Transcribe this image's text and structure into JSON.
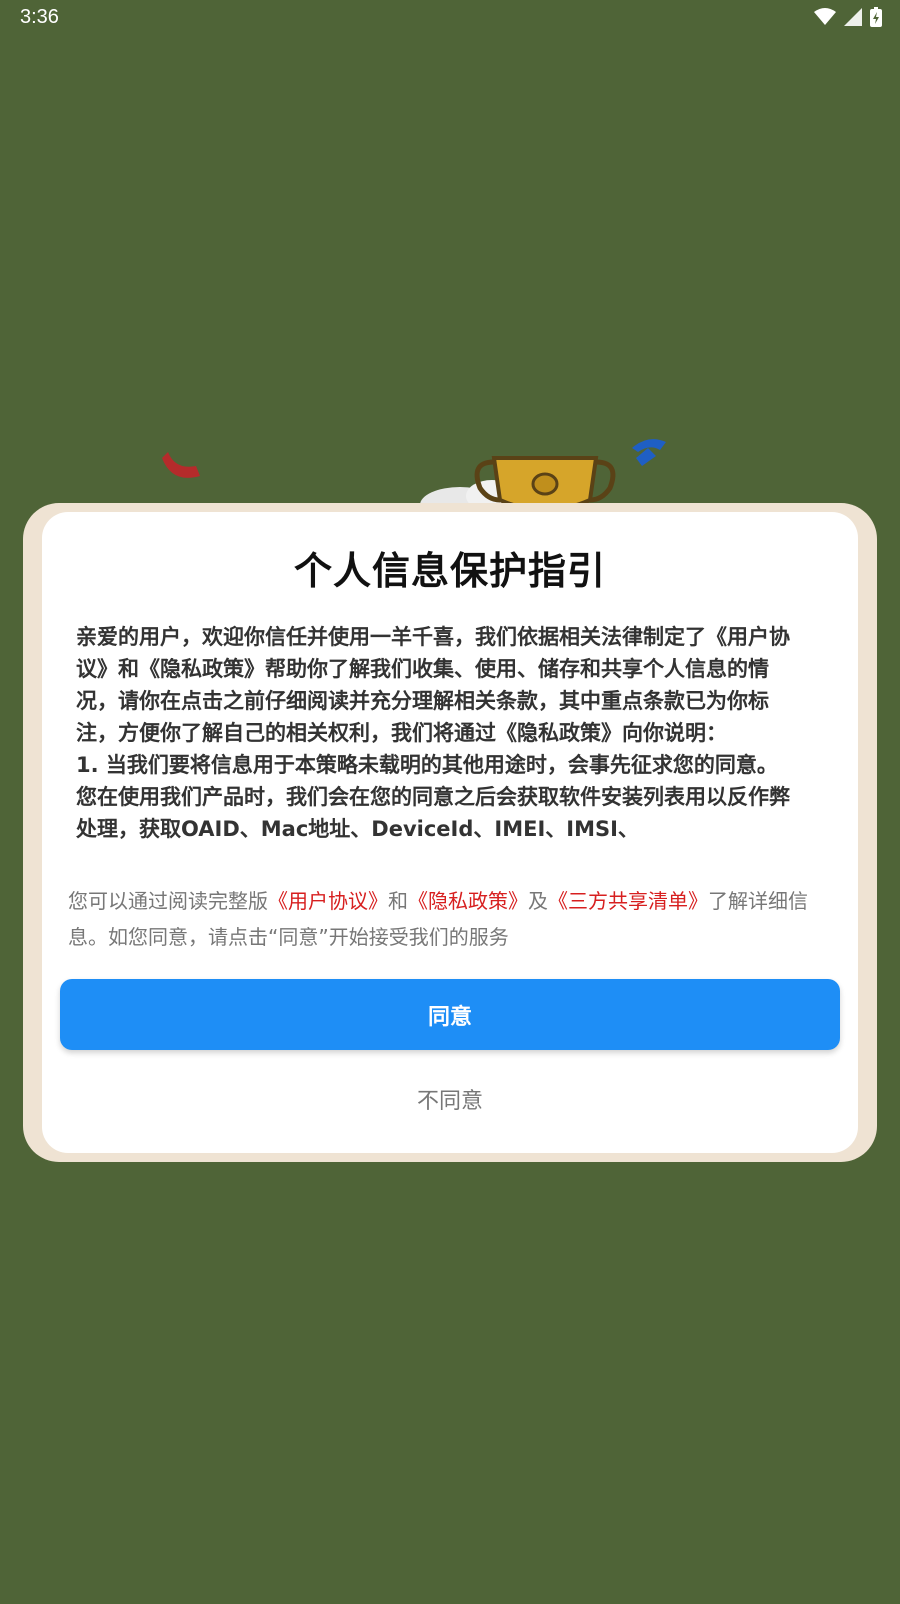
{
  "status_bar": {
    "time": "3:36",
    "icons": [
      "wifi-icon",
      "signal-icon",
      "battery-charging-icon"
    ]
  },
  "background": {
    "color": "#4f6437",
    "art": [
      "confetti-left",
      "confetti-right",
      "trophy",
      "cloud"
    ]
  },
  "dialog": {
    "title": "个人信息保护指引",
    "body": {
      "paragraph_1": "亲爱的用户，欢迎你信任并使用一羊千喜，我们依据相关法律制定了《用户协议》和《隐私政策》帮助你了解我们收集、使用、储存和共享个人信息的情况，请你在点击之前仔细阅读并充分理解相关条款，其中重点条款已为你标注，方便你了解自己的相关权利，我们将通过《隐私政策》向你说明：",
      "paragraph_2": "1. 当我们要将信息用于本策略未载明的其他用途时，会事先征求您的同意。 您在使用我们产品时，我们会在您的同意之后会获取软件安装列表用以反作弊处理，获取OAID、Mac地址、DeviceId、IMEI、IMSI、"
    },
    "note": {
      "prefix": "您可以通过阅读完整版",
      "link_user_agreement": "《用户协议》",
      "and": "和",
      "link_privacy_policy": "《隐私政策》",
      "and2": "及",
      "link_third_party": "《三方共享清单》",
      "suffix": "了解详细信息。如您同意，请点击“同意”开始接受我们的服务"
    },
    "agree_label": "同意",
    "disagree_label": "不同意",
    "colors": {
      "accent": "#1e8ef6",
      "link": "#d71f1f",
      "frame": "#efe3d3"
    }
  }
}
